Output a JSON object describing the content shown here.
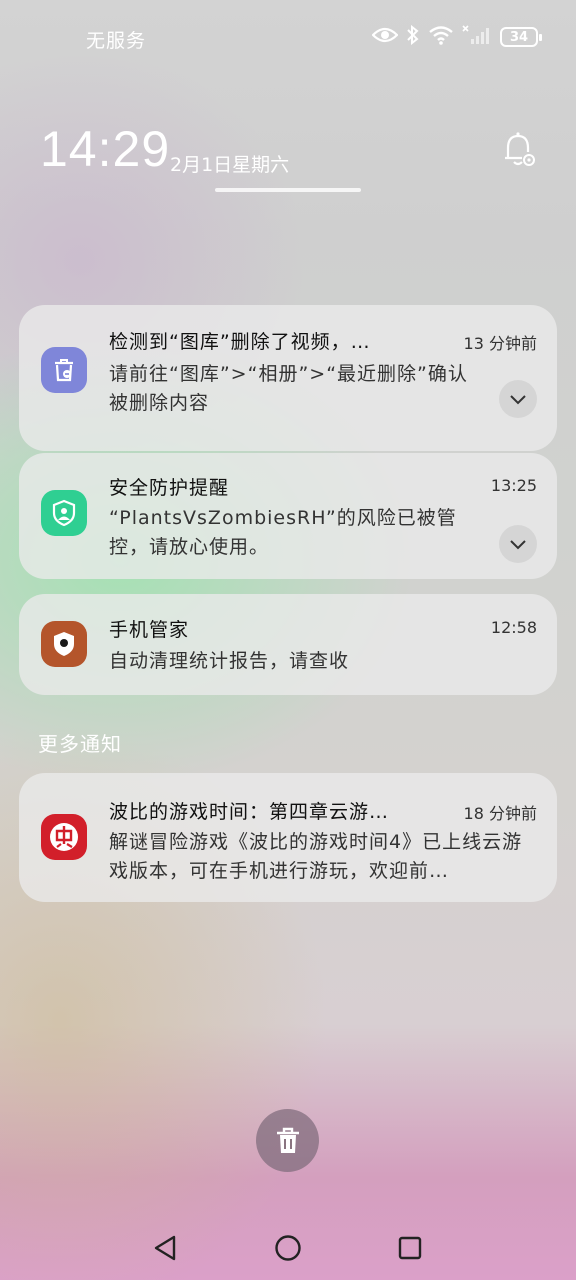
{
  "status_bar": {
    "carrier": "无服务",
    "battery": "34",
    "icons": [
      "eye-icon",
      "bluetooth-icon",
      "wifi-icon",
      "signal-icon",
      "battery-icon"
    ]
  },
  "lockscreen": {
    "time": "14:29",
    "date": "2月1日星期六"
  },
  "notifications": [
    {
      "app_icon": "gallery-trash-icon",
      "title": "检测到“图库”删除了视频，…",
      "time": "13 分钟前",
      "body": "请前往“图库”>“相册”>“最近删除”确认被删除内容",
      "expandable": true
    },
    {
      "app_icon": "security-shield-icon",
      "title": "安全防护提醒",
      "time": "13:25",
      "body": "“PlantsVsZombiesRH”的风险已被管控，请放心使用。",
      "expandable": true
    },
    {
      "app_icon": "phone-manager-icon",
      "title": "手机管家",
      "time": "12:58",
      "body": "自动清理统计报告，请查收",
      "expandable": false
    }
  ],
  "more_section": {
    "label": "更多通知",
    "notifications": [
      {
        "app_icon": "game-app-icon",
        "title": "波比的游戏时间：第四章云游…",
        "time": "18 分钟前",
        "body": "解谜冒险游戏《波比的游戏时间4》已上线云游戏版本，可在手机进行游玩，欢迎前…"
      }
    ]
  },
  "colors": {
    "gallery_icon": "#7f86d9",
    "security_icon": "#2fcf92",
    "manager_icon": "#b4552b",
    "game_icon": "#d21f2a"
  }
}
